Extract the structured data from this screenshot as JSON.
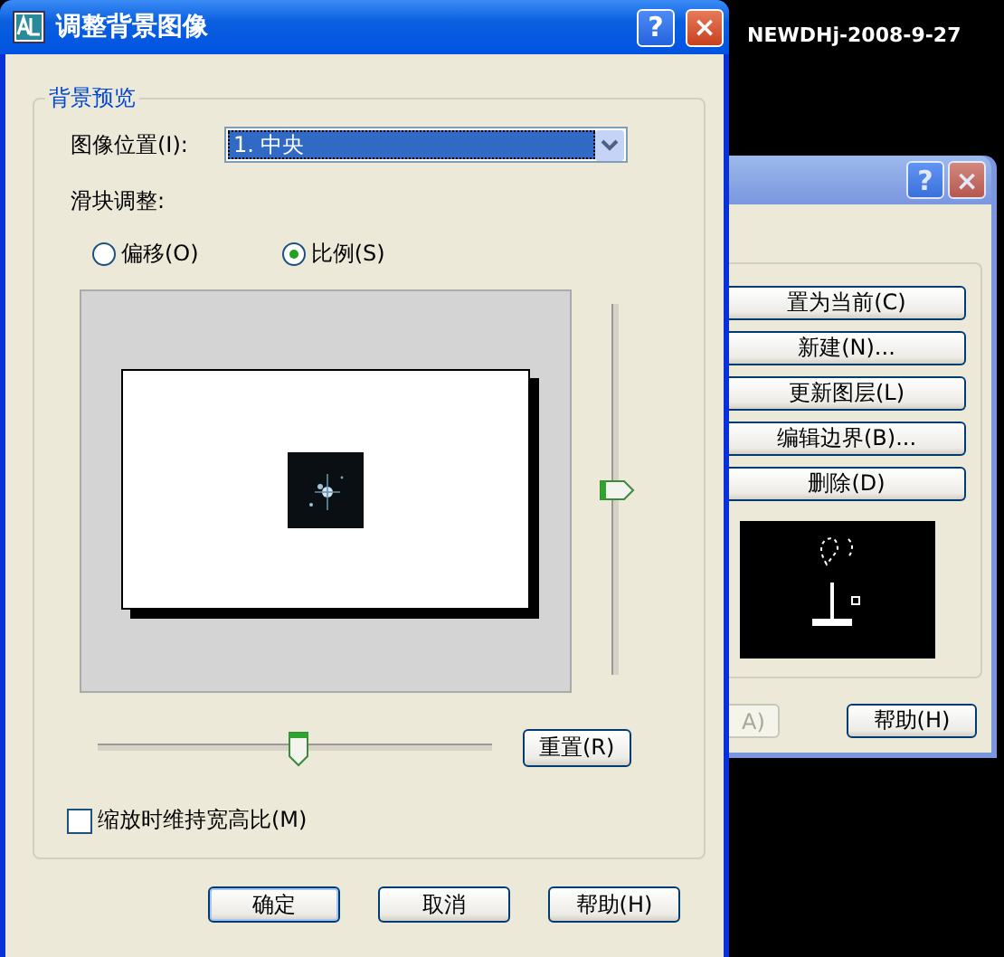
{
  "dialog": {
    "title": "调整背景图像",
    "help_button": "?",
    "close_button": "×",
    "group_title": "背景预览",
    "position_label": "图像位置(I):",
    "position_value": "1. 中央",
    "slider_label": "滑块调整:",
    "modes": [
      {
        "label": "偏移(O)",
        "selected": false
      },
      {
        "label": "比例(S)",
        "selected": true
      }
    ],
    "vertical_slider": {
      "level": 0.5
    },
    "horizontal_slider": {
      "level": 0.51
    },
    "reset_button": "重置(R)",
    "keep_ratio": {
      "label": "缩放时维持宽高比(M)",
      "checked": false
    },
    "buttons": [
      "确定",
      "取消",
      "帮助(H)"
    ]
  },
  "background_text": "NEWDHj-2008-9-27",
  "back_dialog": {
    "help_button": "?",
    "close_button": "×",
    "buttons": [
      {
        "label": "置为当前(C)"
      },
      {
        "label": "新建(N)..."
      },
      {
        "label": "更新图层(L)"
      },
      {
        "label": "编辑边界(B)..."
      },
      {
        "label": "删除(D)"
      }
    ],
    "bottom_buttons": [
      {
        "label": "A)",
        "disabled": true
      },
      {
        "label": "帮助(H)",
        "disabled": false
      }
    ]
  }
}
